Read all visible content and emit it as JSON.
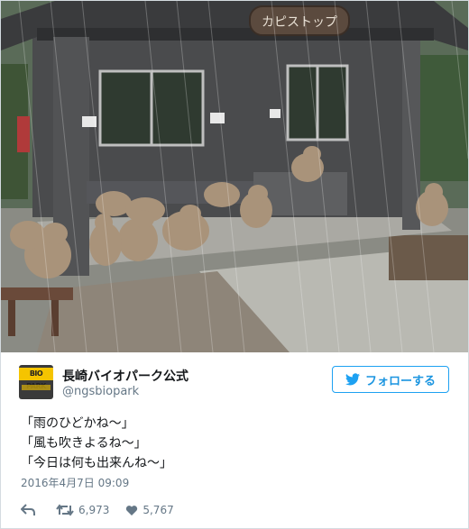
{
  "photo": {
    "sign_text": "カピストップ",
    "description_icon": "capybaras-in-rain-photo"
  },
  "account": {
    "display_name": "長崎バイオパーク公式",
    "handle": "@ngsbiopark",
    "avatar_text": "BIO PARK"
  },
  "follow_button": {
    "label": "フォローする",
    "icon": "twitter-bird-icon"
  },
  "tweet": {
    "lines": [
      "「雨のひどかね〜」",
      "「風も吹きよるね〜」",
      "「今日は何も出来んね〜」"
    ],
    "timestamp": "2016年4月7日 09:09"
  },
  "actions": {
    "reply_icon": "reply-icon",
    "retweet_count": "6,973",
    "like_count": "5,767"
  },
  "colors": {
    "accent": "#1da1f2",
    "text": "#14171a",
    "muted": "#657786"
  }
}
